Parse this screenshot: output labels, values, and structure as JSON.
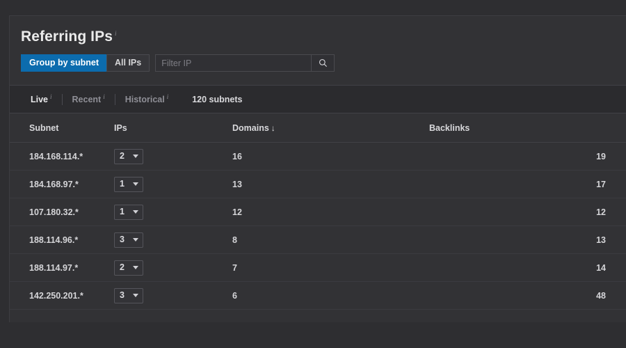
{
  "panel": {
    "title": "Referring IPs",
    "info_marker": "i"
  },
  "controls": {
    "segments": [
      {
        "label": "Group by subnet",
        "active": true
      },
      {
        "label": "All IPs",
        "active": false
      }
    ],
    "filter": {
      "placeholder": "Filter IP",
      "value": ""
    },
    "search_icon": "search-icon"
  },
  "tabs": [
    {
      "label": "Live",
      "info_marker": "i",
      "active": true
    },
    {
      "label": "Recent",
      "info_marker": "i",
      "active": false
    },
    {
      "label": "Historical",
      "info_marker": "i",
      "active": false
    }
  ],
  "summary": "120 subnets",
  "table": {
    "columns": [
      {
        "key": "subnet",
        "label": "Subnet",
        "sorted": false
      },
      {
        "key": "ips",
        "label": "IPs",
        "sorted": false
      },
      {
        "key": "domains",
        "label": "Domains",
        "sorted": true,
        "sort_arrow": "↓"
      },
      {
        "key": "backlinks",
        "label": "Backlinks",
        "sorted": false
      }
    ],
    "rows": [
      {
        "subnet": "184.168.114.*",
        "ips": "2",
        "domains": "16",
        "backlinks": "19"
      },
      {
        "subnet": "184.168.97.*",
        "ips": "1",
        "domains": "13",
        "backlinks": "17"
      },
      {
        "subnet": "107.180.32.*",
        "ips": "1",
        "domains": "12",
        "backlinks": "12"
      },
      {
        "subnet": "188.114.96.*",
        "ips": "3",
        "domains": "8",
        "backlinks": "13"
      },
      {
        "subnet": "188.114.97.*",
        "ips": "2",
        "domains": "7",
        "backlinks": "14"
      },
      {
        "subnet": "142.250.201.*",
        "ips": "3",
        "domains": "6",
        "backlinks": "48"
      }
    ]
  },
  "colors": {
    "page_background": "#2e2e31",
    "card_background": "#323235",
    "tabstrip_background": "#2b2b2e",
    "accent_blue": "#0c6cae",
    "text_primary": "#d9d9dc",
    "text_muted": "#8f8f96",
    "border": "#414146"
  }
}
